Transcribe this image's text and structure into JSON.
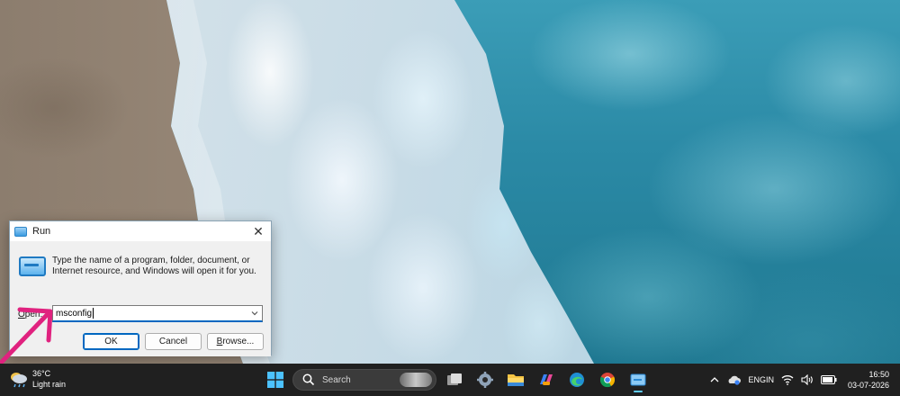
{
  "run_dialog": {
    "title": "Run",
    "description": "Type the name of a program, folder, document, or Internet resource, and Windows will open it for you.",
    "open_label_access": "O",
    "open_label_rest": "pen:",
    "open_value": "msconfig",
    "ok_label": "OK",
    "cancel_label": "Cancel",
    "browse_label_access": "B",
    "browse_label_rest": "rowse...",
    "close_glyph": "✕",
    "icon": "run-icon"
  },
  "taskbar": {
    "weather": {
      "temp": "36°C",
      "condition": "Light rain",
      "icon": "cloud-rain-icon"
    },
    "search": {
      "placeholder": "Search"
    },
    "pinned_apps": [
      "windows-start-icon",
      "task-view-icon",
      "settings-icon",
      "file-explorer-icon",
      "copilot-icon",
      "edge-icon",
      "chrome-icon",
      "run-icon"
    ],
    "tray": {
      "language_line1": "ENG",
      "language_line2": "IN",
      "time": "16:50",
      "date": "03-07-2026",
      "icons": [
        "chevron-up-icon",
        "onedrive-icon",
        "wifi-icon",
        "volume-icon",
        "battery-icon"
      ]
    }
  },
  "colors": {
    "taskbar_bg": "#202020",
    "accent": "#0067c0",
    "annotation": "#e0227f"
  }
}
